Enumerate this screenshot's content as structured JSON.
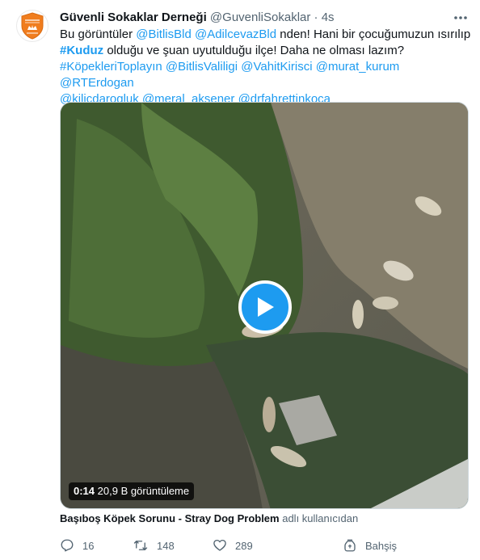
{
  "tweet": {
    "author_name": "Güvenli Sokaklar Derneği",
    "author_handle": "@GuvenliSokaklar",
    "separator": "·",
    "time": "4s",
    "more_label": "···",
    "text": {
      "t1": "Bu görüntüler ",
      "m1": "@BitlisBld",
      "t2": " ",
      "m2": "@AdilcevazBld",
      "t3": " nden! Hani bir çocuğumuzun ısırılıp",
      "h1": "#Kuduz",
      "t4": " olduğu ve şuan uyutulduğu ilçe! Daha ne olması lazım?",
      "h2": "#KöpekleriToplayın",
      "m3": "@BitlisValiligi",
      "m4": "@VahitKirisci",
      "m5": "@murat_kurum",
      "m6": "@RTErdogan",
      "m7": "@kilicdarogluk",
      "m8": "@meral_aksener",
      "m9": "@drfahrettinkoca"
    },
    "media": {
      "duration": "0:14",
      "views": "20,9 B görüntüleme"
    },
    "attribution": {
      "title": "Başıboş Köpek Sorunu - Stray Dog Problem",
      "suffix": " adlı kullanıcıdan"
    },
    "actions": {
      "replies": "16",
      "retweets": "148",
      "likes": "289",
      "tip_label": "Bahşiş"
    }
  },
  "colors": {
    "link": "#1d9bf0",
    "text": "#0f1419",
    "secondary": "#536471",
    "avatar_accent": "#f07d1e"
  },
  "icons": [
    "organization-logo-icon",
    "more-icon",
    "play-icon",
    "reply-icon",
    "retweet-icon",
    "like-icon",
    "tip-icon"
  ]
}
